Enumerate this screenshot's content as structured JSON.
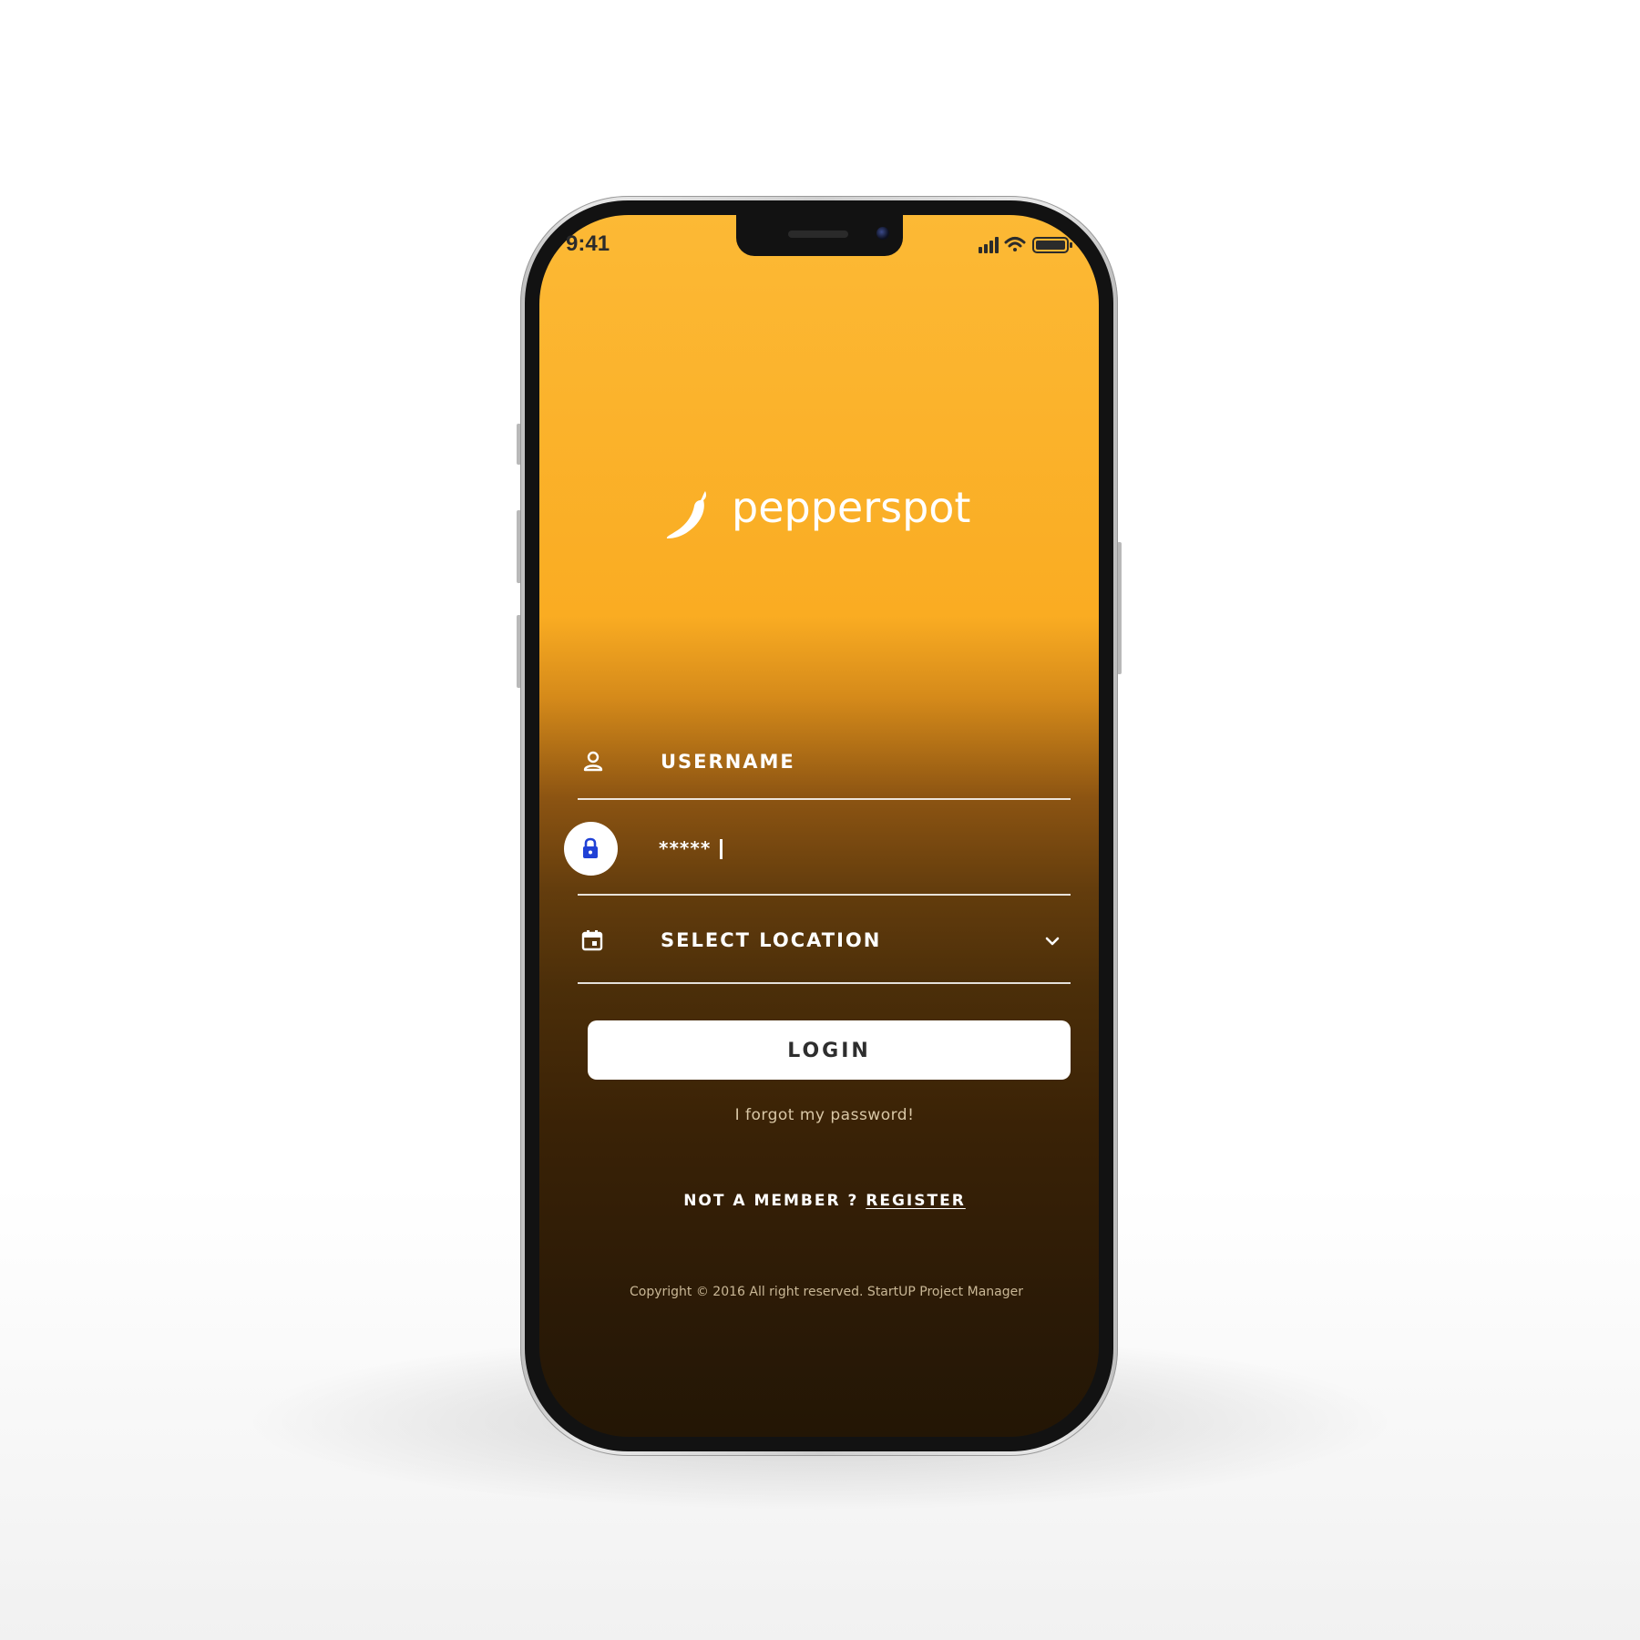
{
  "status_bar": {
    "time": "9:41",
    "signal_icon": "cellular-signal-icon",
    "wifi_icon": "wifi-icon",
    "battery_icon": "battery-icon"
  },
  "brand": {
    "logo_icon": "chili-pepper-icon",
    "name": "pepperspot"
  },
  "form": {
    "username": {
      "icon": "user-icon",
      "placeholder": "USERNAME",
      "value": ""
    },
    "password": {
      "icon": "lock-icon",
      "value": "*****"
    },
    "location": {
      "icon": "calendar-icon",
      "label": "SELECT LOCATION",
      "dropdown_icon": "chevron-down-icon"
    },
    "login_label": "LOGIN",
    "forgot_label": "I forgot my password!",
    "not_member_label": "NOT A MEMBER ?",
    "register_label": "REGISTER",
    "copyright": "Copyright © 2016 All right reserved. StartUP Project Manager"
  },
  "colors": {
    "gradient_top": "#fcb935",
    "gradient_mid": "#faac22",
    "gradient_bottom": "#231605",
    "lock_accent": "#2041d6",
    "button_bg": "#ffffff",
    "button_text": "#2e2e2e"
  }
}
